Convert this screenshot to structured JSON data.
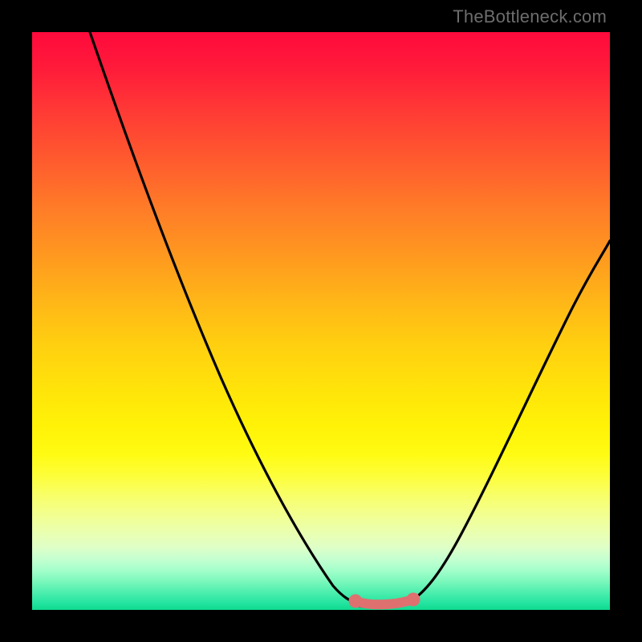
{
  "watermark": "TheBottleneck.com",
  "chart_data": {
    "type": "line",
    "title": "",
    "xlabel": "",
    "ylabel": "",
    "xlim": [
      0,
      100
    ],
    "ylim": [
      0,
      100
    ],
    "grid": false,
    "series": [
      {
        "name": "left-curve",
        "x": [
          10,
          14,
          18,
          22,
          26,
          30,
          34,
          38,
          42,
          46,
          48,
          50,
          52,
          54,
          56
        ],
        "y": [
          100,
          92,
          84,
          76,
          68,
          59,
          50,
          41,
          31,
          20,
          14,
          9,
          5,
          2.5,
          1.5
        ]
      },
      {
        "name": "flat-segment",
        "x": [
          56,
          58,
          60,
          62,
          64,
          66
        ],
        "y": [
          1.5,
          1,
          1,
          1,
          1.2,
          1.8
        ]
      },
      {
        "name": "right-curve",
        "x": [
          66,
          68,
          70,
          72,
          74,
          78,
          82,
          86,
          90,
          94,
          98,
          100
        ],
        "y": [
          1.8,
          3,
          5,
          7.5,
          10.5,
          17,
          24,
          32,
          41,
          50,
          59,
          64
        ]
      }
    ],
    "highlight": {
      "name": "flat-highlight",
      "x": [
        56,
        66
      ],
      "y": [
        1.5,
        1.8
      ],
      "color": "#de7070"
    },
    "gradient_axis": "y",
    "gradient_colors_top_to_bottom": [
      "#ff0a3c",
      "#ffcf10",
      "#fff207",
      "#10d98d"
    ]
  }
}
